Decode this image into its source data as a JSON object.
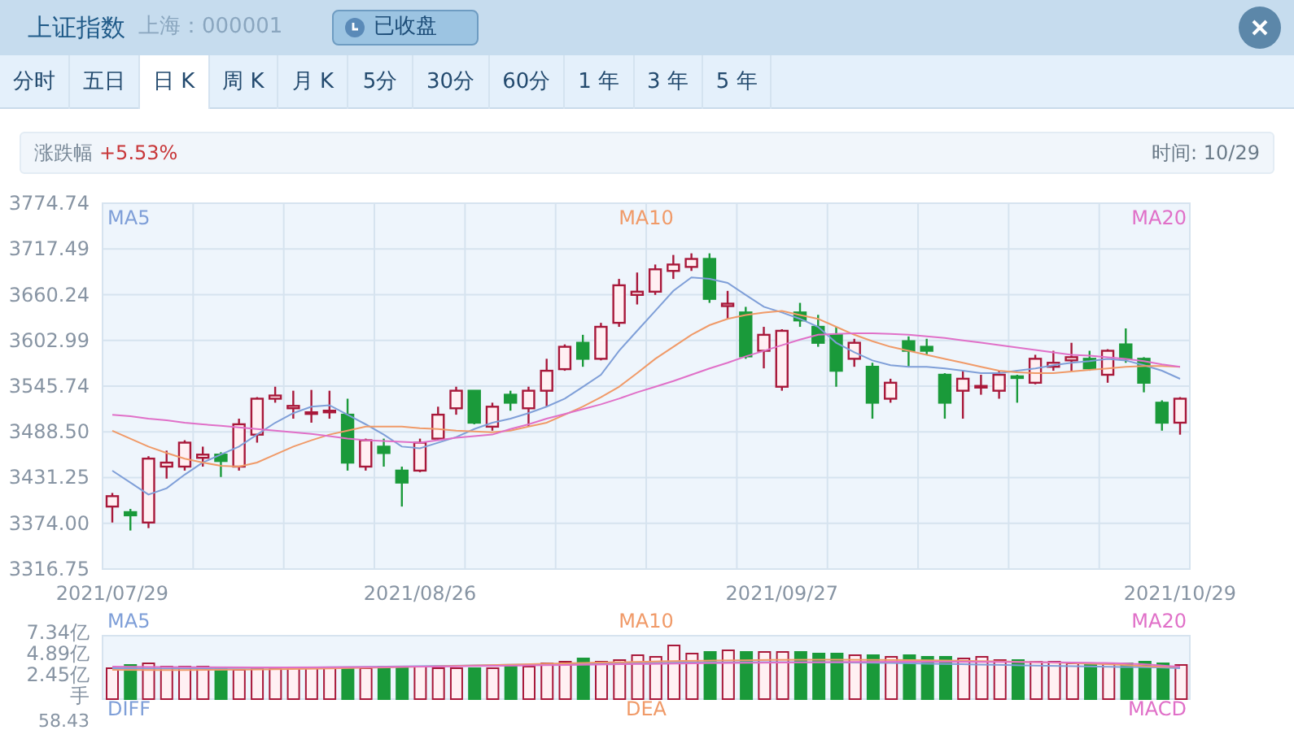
{
  "header": {
    "title": "上证指数",
    "market": "上海：000001",
    "status_button": "已收盘"
  },
  "tabs": [
    {
      "label": "分时",
      "selected": false
    },
    {
      "label": "五日",
      "selected": false
    },
    {
      "label": "日 K",
      "selected": true
    },
    {
      "label": "周 K",
      "selected": false
    },
    {
      "label": "月 K",
      "selected": false
    },
    {
      "label": "5分",
      "selected": false
    },
    {
      "label": "30分",
      "selected": false
    },
    {
      "label": "60分",
      "selected": false
    },
    {
      "label": "1 年",
      "selected": false
    },
    {
      "label": "3 年",
      "selected": false
    },
    {
      "label": "5 年",
      "selected": false
    }
  ],
  "info_bar": {
    "change_label": "涨跌幅",
    "change_value": "+5.53%",
    "time": "时间: 10/29"
  },
  "kline": {
    "chart_data": {
      "type": "candlestick",
      "categories": [
        "2021/07/29",
        null,
        null,
        null,
        null,
        null,
        null,
        null,
        null,
        null,
        null,
        null,
        null,
        null,
        null,
        null,
        null,
        "2021/08/26",
        null,
        null,
        null,
        null,
        null,
        null,
        null,
        null,
        null,
        null,
        null,
        null,
        null,
        null,
        null,
        null,
        null,
        null,
        null,
        "2021/09/27",
        null,
        null,
        null,
        null,
        null,
        null,
        null,
        null,
        null,
        null,
        null,
        null,
        null,
        null,
        null,
        null,
        null,
        null,
        null,
        null,
        null,
        "2021/10/29"
      ],
      "ohlc": [
        [
          3395,
          3412,
          3375,
          3408
        ],
        [
          3388,
          3392,
          3365,
          3384
        ],
        [
          3375,
          3458,
          3368,
          3455
        ],
        [
          3445,
          3465,
          3430,
          3450
        ],
        [
          3445,
          3478,
          3440,
          3475
        ],
        [
          3456,
          3470,
          3445,
          3460
        ],
        [
          3460,
          3463,
          3432,
          3452
        ],
        [
          3445,
          3505,
          3440,
          3498
        ],
        [
          3485,
          3532,
          3475,
          3530
        ],
        [
          3530,
          3545,
          3525,
          3534
        ],
        [
          3518,
          3540,
          3505,
          3521
        ],
        [
          3511,
          3541,
          3500,
          3513
        ],
        [
          3513,
          3540,
          3505,
          3515
        ],
        [
          3510,
          3530,
          3440,
          3450
        ],
        [
          3445,
          3480,
          3440,
          3478
        ],
        [
          3470,
          3480,
          3445,
          3462
        ],
        [
          3440,
          3445,
          3395,
          3425
        ],
        [
          3440,
          3480,
          3438,
          3475
        ],
        [
          3480,
          3520,
          3478,
          3510
        ],
        [
          3518,
          3545,
          3510,
          3540
        ],
        [
          3540,
          3540,
          3498,
          3500
        ],
        [
          3495,
          3525,
          3490,
          3520
        ],
        [
          3535,
          3540,
          3515,
          3525
        ],
        [
          3518,
          3545,
          3495,
          3540
        ],
        [
          3540,
          3580,
          3520,
          3565
        ],
        [
          3567,
          3598,
          3565,
          3595
        ],
        [
          3600,
          3610,
          3570,
          3580
        ],
        [
          3580,
          3625,
          3578,
          3620
        ],
        [
          3625,
          3680,
          3620,
          3672
        ],
        [
          3660,
          3688,
          3648,
          3664
        ],
        [
          3664,
          3698,
          3660,
          3692
        ],
        [
          3690,
          3710,
          3680,
          3698
        ],
        [
          3695,
          3712,
          3690,
          3705
        ],
        [
          3705,
          3712,
          3650,
          3655
        ],
        [
          3646,
          3665,
          3630,
          3649
        ],
        [
          3638,
          3645,
          3580,
          3583
        ],
        [
          3590,
          3620,
          3568,
          3610
        ],
        [
          3545,
          3617,
          3540,
          3615
        ],
        [
          3638,
          3650,
          3620,
          3628
        ],
        [
          3620,
          3635,
          3595,
          3600
        ],
        [
          3610,
          3620,
          3545,
          3565
        ],
        [
          3580,
          3605,
          3570,
          3600
        ],
        [
          3570,
          3575,
          3505,
          3525
        ],
        [
          3530,
          3555,
          3525,
          3550
        ],
        [
          3602,
          3608,
          3570,
          3590
        ],
        [
          3595,
          3605,
          3585,
          3590
        ],
        [
          3560,
          3562,
          3505,
          3525
        ],
        [
          3540,
          3565,
          3505,
          3555
        ],
        [
          3544,
          3560,
          3535,
          3546
        ],
        [
          3540,
          3565,
          3530,
          3560
        ],
        [
          3558,
          3560,
          3525,
          3557
        ],
        [
          3550,
          3585,
          3548,
          3580
        ],
        [
          3570,
          3590,
          3565,
          3575
        ],
        [
          3578,
          3600,
          3565,
          3582
        ],
        [
          3580,
          3590,
          3565,
          3568
        ],
        [
          3560,
          3592,
          3550,
          3590
        ],
        [
          3598,
          3618,
          3575,
          3580
        ],
        [
          3580,
          3582,
          3538,
          3550
        ],
        [
          3525,
          3528,
          3490,
          3500
        ],
        [
          3500,
          3532,
          3485,
          3530
        ]
      ],
      "series": [
        {
          "name": "MA5",
          "type": "line",
          "color": "#7f9fd8",
          "values": [
            3440,
            3425,
            3410,
            3418,
            3435,
            3450,
            3460,
            3470,
            3485,
            3500,
            3512,
            3520,
            3522,
            3510,
            3498,
            3485,
            3470,
            3468,
            3475,
            3482,
            3492,
            3500,
            3505,
            3512,
            3520,
            3530,
            3545,
            3560,
            3590,
            3615,
            3640,
            3665,
            3682,
            3680,
            3675,
            3660,
            3645,
            3638,
            3630,
            3620,
            3600,
            3588,
            3578,
            3572,
            3570,
            3570,
            3568,
            3565,
            3562,
            3562,
            3565,
            3568,
            3572,
            3575,
            3577,
            3580,
            3578,
            3572,
            3565,
            3555
          ]
        },
        {
          "name": "MA10",
          "type": "line",
          "color": "#f09a68",
          "values": [
            3490,
            3480,
            3470,
            3462,
            3455,
            3450,
            3446,
            3445,
            3450,
            3460,
            3470,
            3478,
            3485,
            3490,
            3495,
            3495,
            3495,
            3493,
            3492,
            3490,
            3489,
            3488,
            3490,
            3495,
            3500,
            3510,
            3520,
            3532,
            3545,
            3562,
            3580,
            3595,
            3610,
            3622,
            3630,
            3635,
            3638,
            3640,
            3635,
            3630,
            3620,
            3610,
            3602,
            3595,
            3590,
            3585,
            3580,
            3575,
            3570,
            3565,
            3563,
            3562,
            3562,
            3564,
            3566,
            3568,
            3570,
            3571,
            3571,
            3570
          ]
        },
        {
          "name": "MA20",
          "type": "line",
          "color": "#e070c8",
          "values": [
            3510,
            3508,
            3505,
            3503,
            3500,
            3498,
            3496,
            3494,
            3492,
            3490,
            3488,
            3486,
            3483,
            3480,
            3478,
            3477,
            3476,
            3475,
            3478,
            3481,
            3483,
            3485,
            3492,
            3498,
            3505,
            3511,
            3517,
            3523,
            3530,
            3538,
            3545,
            3552,
            3560,
            3568,
            3575,
            3583,
            3590,
            3597,
            3604,
            3610,
            3611,
            3612,
            3612,
            3611,
            3610,
            3608,
            3606,
            3603,
            3600,
            3597,
            3594,
            3591,
            3588,
            3585,
            3584,
            3582,
            3580,
            3577,
            3573,
            3570
          ]
        }
      ],
      "ylim": [
        3316.75,
        3774.74
      ],
      "grid": true,
      "yticks": [
        {
          "value": 3774.74,
          "label": "3774.74"
        },
        {
          "value": 3717.49,
          "label": "3717.49"
        },
        {
          "value": 3660.24,
          "label": "3660.24"
        },
        {
          "value": 3602.99,
          "label": "3602.99"
        },
        {
          "value": 3545.74,
          "label": "3545.74"
        },
        {
          "value": 3488.5,
          "label": "3488.50"
        },
        {
          "value": 3431.25,
          "label": "3431.25"
        },
        {
          "value": 3374,
          "label": "3374.00"
        },
        {
          "value": 3316.75,
          "label": "3316.75"
        }
      ]
    }
  },
  "volume": {
    "legend": [
      {
        "label": "MA5",
        "color": "#7f9fd8"
      },
      {
        "label": "MA10",
        "color": "#f09a68"
      },
      {
        "label": "MA20",
        "color": "#e070c8"
      }
    ],
    "y_axis_labels": [
      "7.34亿",
      "4.89亿",
      "2.45亿",
      "手"
    ]
  },
  "macd": {
    "legend": [
      {
        "label": "DIFF",
        "color": "#7f9fd8"
      },
      {
        "label": "DEA",
        "color": "#f09a68"
      },
      {
        "label": "MACD",
        "color": "#e070c8"
      }
    ],
    "y_axis_labels": [
      "58.43"
    ]
  }
}
